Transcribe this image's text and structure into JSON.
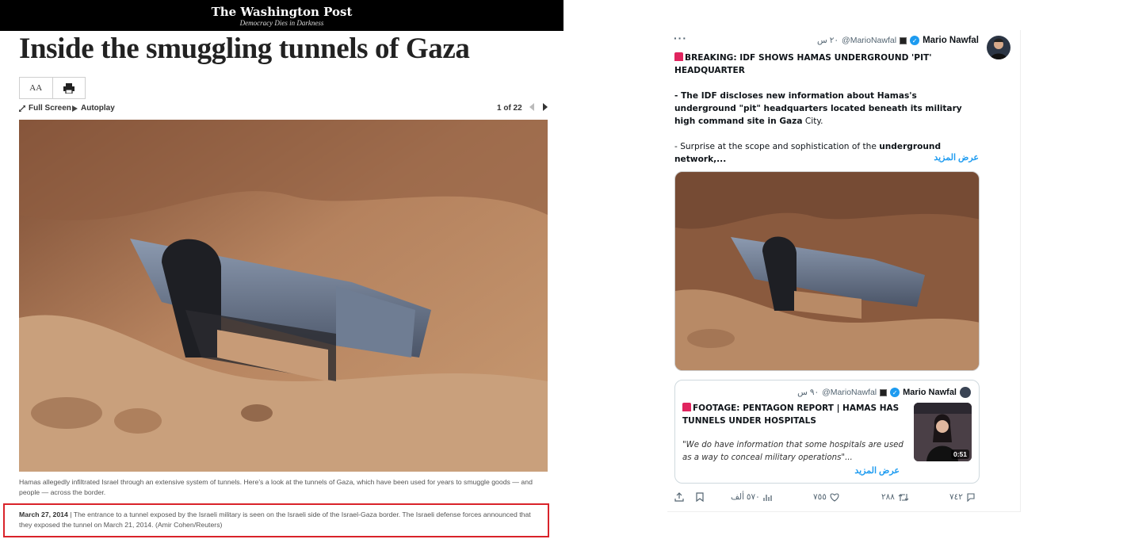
{
  "wapo": {
    "logo": "The Washington Post",
    "tagline": "Democracy Dies in Darkness",
    "title": "Inside the smuggling tunnels of Gaza",
    "text_size_label": "AA",
    "full_screen_label": "Full Screen",
    "autoplay_label": "Autoplay",
    "counter": "1 of 22",
    "caption_intro": "Hamas allegedly infiltrated Israel through an extensive system of tunnels. Here’s a look at the tunnels of Gaza, which have been used for years to smuggle goods — and people — across the border.",
    "caption_date": "March 27, 2014",
    "caption_text": "The entrance to a tunnel exposed by the Israeli military is seen on the Israeli side of the Israel-Gaza border. The Israeli defense forces announced that they exposed the tunnel on March 21, 2014. (Amir Cohen/Reuters)",
    "highlight_color": "#d9232a"
  },
  "tweet": {
    "name": "Mario Nawfal",
    "handle": "@MarioNawfal",
    "time": "٢٠ س",
    "line1": "BREAKING: IDF SHOWS HAMAS UNDERGROUND 'PIT' HEADQUARTER",
    "p2_a": "- The IDF discloses new information about Hamas's underground \"pit\" headquarters located beneath its military high command site in Gaza",
    "p2_b": " City.",
    "p3_a": "- Surprise at the scope and sophistication of the ",
    "p3_b": "underground network,...",
    "show_more": "عرض المزيد",
    "quote": {
      "name": "Mario Nawfal",
      "handle": "@MarioNawfal",
      "time": "٩٠ س",
      "headline": "FOOTAGE: PENTAGON REPORT | HAMAS HAS TUNNELS UNDER HOSPITALS",
      "quote_text": "\"We do have information that some hospitals are used as a way to conceal military operations\"...",
      "show_more": "عرض المزيد",
      "duration": "0:51"
    },
    "actions": {
      "replies": "٧٤٢",
      "retweets": "٢٨٨",
      "likes": "٧٥٥",
      "views": "٥٧٠ ألف"
    },
    "accent_color": "#1d9bf0"
  }
}
